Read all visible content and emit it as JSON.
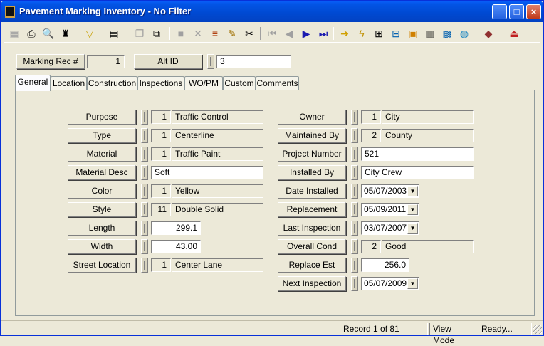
{
  "window": {
    "title": "Pavement Marking Inventory - No Filter"
  },
  "record": {
    "marking_rec_label": "Marking Rec #",
    "marking_rec_value": "1",
    "alt_id_label": "Alt ID",
    "alt_id_value": "3"
  },
  "tabs": [
    "General",
    "Location",
    "Construction",
    "Inspections",
    "WO/PM",
    "Custom",
    "Comments"
  ],
  "left": {
    "purpose": {
      "label": "Purpose",
      "code": "1",
      "value": "Traffic Control"
    },
    "type": {
      "label": "Type",
      "code": "1",
      "value": "Centerline"
    },
    "material": {
      "label": "Material",
      "code": "1",
      "value": "Traffic Paint"
    },
    "material_desc": {
      "label": "Material Desc",
      "value": "Soft"
    },
    "color": {
      "label": "Color",
      "code": "1",
      "value": "Yellow"
    },
    "style": {
      "label": "Style",
      "code": "11",
      "value": "Double Solid"
    },
    "length": {
      "label": "Length",
      "value": "299.1"
    },
    "width": {
      "label": "Width",
      "value": "43.00"
    },
    "street_location": {
      "label": "Street Location",
      "code": "1",
      "value": "Center Lane"
    }
  },
  "right": {
    "owner": {
      "label": "Owner",
      "code": "1",
      "value": "City"
    },
    "maintained_by": {
      "label": "Maintained By",
      "code": "2",
      "value": "County"
    },
    "project_number": {
      "label": "Project Number",
      "value": "521"
    },
    "installed_by": {
      "label": "Installed By",
      "value": "City Crew"
    },
    "date_installed": {
      "label": "Date Installed",
      "value": "05/07/2003"
    },
    "replacement": {
      "label": "Replacement",
      "value": "05/09/2011"
    },
    "last_inspection": {
      "label": "Last Inspection",
      "value": "03/07/2007"
    },
    "overall_cond": {
      "label": "Overall Cond",
      "code": "2",
      "value": "Good"
    },
    "replace_est": {
      "label": "Replace Est",
      "value": "256.0"
    },
    "next_inspection": {
      "label": "Next Inspection",
      "value": "05/07/2009"
    }
  },
  "status": {
    "record": "Record 1 of 81",
    "mode": "View Mode",
    "state": "Ready..."
  },
  "glyphs": {
    "minimize": "_",
    "maximize": "□",
    "close": "×",
    "dropdown": "▼"
  },
  "toolbar_icons": [
    "grid-icon",
    "print-icon",
    "preview-icon",
    "binoculars-icon",
    "filter-icon",
    "form-icon",
    "copy-icon",
    "duplicate-icon",
    "stop-icon",
    "delete-icon",
    "books-icon",
    "pencil-icon",
    "scissors-icon",
    "first-icon",
    "prev-icon",
    "next-icon",
    "last-icon",
    "arrow-icon",
    "lightning-icon",
    "tree-icon",
    "hierarchy-icon",
    "map-icon",
    "calculator-icon",
    "chart-icon",
    "globe-icon",
    "book-icon",
    "exit-icon"
  ],
  "colors": {
    "title_bar": "#0355e6",
    "face": "#ece9d8"
  }
}
